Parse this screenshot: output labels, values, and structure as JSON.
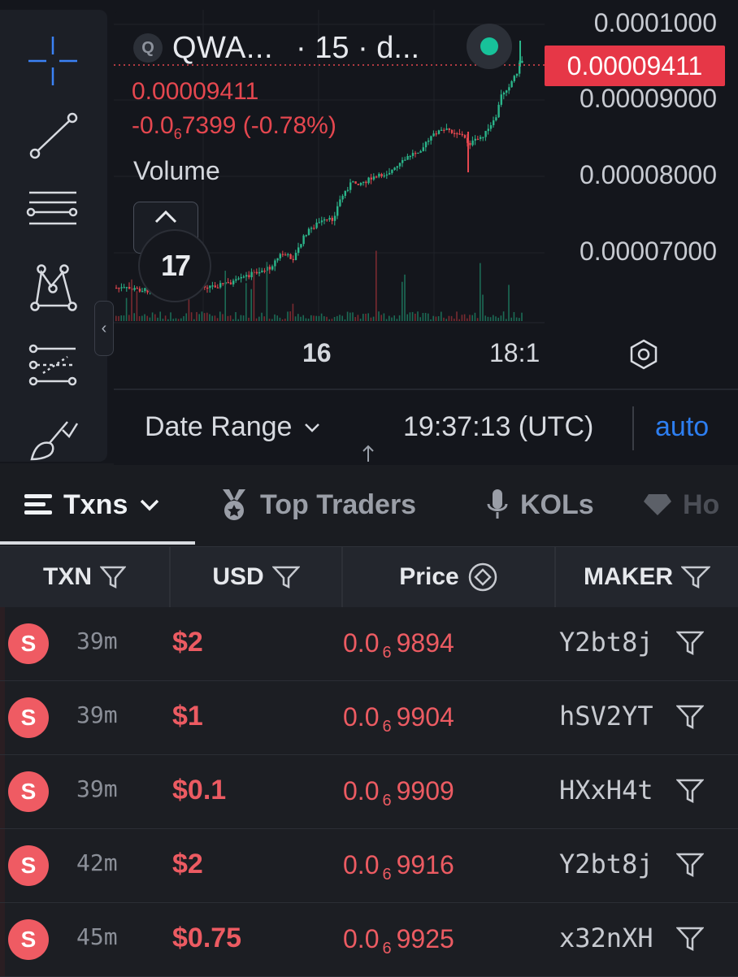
{
  "chart": {
    "symbol_badge": "Q",
    "symbol_name": "QWA...",
    "interval_info": "· 15 · d...",
    "legend_price": "0.00009411",
    "legend_change_prefix": "-0.0",
    "legend_change_zero_count": "6",
    "legend_change_suffix": "7399 (-0.78%)",
    "legend_volume": "Volume",
    "last_price_tag": "0.00009411",
    "y_axis_labels": [
      "0.0001000",
      "0.00009000",
      "0.00008000",
      "0.00007000"
    ],
    "x_axis_labels": [
      "16",
      "18:1"
    ],
    "date_range_label": "Date Range",
    "clock": "19:37:13 (UTC)",
    "auto_label": "auto",
    "up_color": "#2bb58a",
    "down_color": "#e5474f",
    "tradingview_logo": "17"
  },
  "tabs": [
    {
      "label": "Txns",
      "icon": "list-icon",
      "active": true
    },
    {
      "label": "Top Traders",
      "icon": "medal-icon",
      "active": false
    },
    {
      "label": "KOLs",
      "icon": "microphone-icon",
      "active": false
    },
    {
      "label": "Ho",
      "icon": "diamond-icon",
      "active": false
    }
  ],
  "table": {
    "headers": [
      "TXN",
      "USD",
      "Price",
      "MAKER"
    ],
    "rows": [
      {
        "side": "S",
        "age": "39m",
        "usd": "$2",
        "price_prefix": "0.0",
        "price_zeros": "6",
        "price_suffix": "9894",
        "maker": "Y2bt8j"
      },
      {
        "side": "S",
        "age": "39m",
        "usd": "$1",
        "price_prefix": "0.0",
        "price_zeros": "6",
        "price_suffix": "9904",
        "maker": "hSV2YT"
      },
      {
        "side": "S",
        "age": "39m",
        "usd": "$0.1",
        "price_prefix": "0.0",
        "price_zeros": "6",
        "price_suffix": "9909",
        "maker": "HXxH4t"
      },
      {
        "side": "S",
        "age": "42m",
        "usd": "$2",
        "price_prefix": "0.0",
        "price_zeros": "6",
        "price_suffix": "9916",
        "maker": "Y2bt8j"
      },
      {
        "side": "S",
        "age": "45m",
        "usd": "$0.75",
        "price_prefix": "0.0",
        "price_zeros": "6",
        "price_suffix": "9925",
        "maker": "x32nXH"
      }
    ]
  }
}
